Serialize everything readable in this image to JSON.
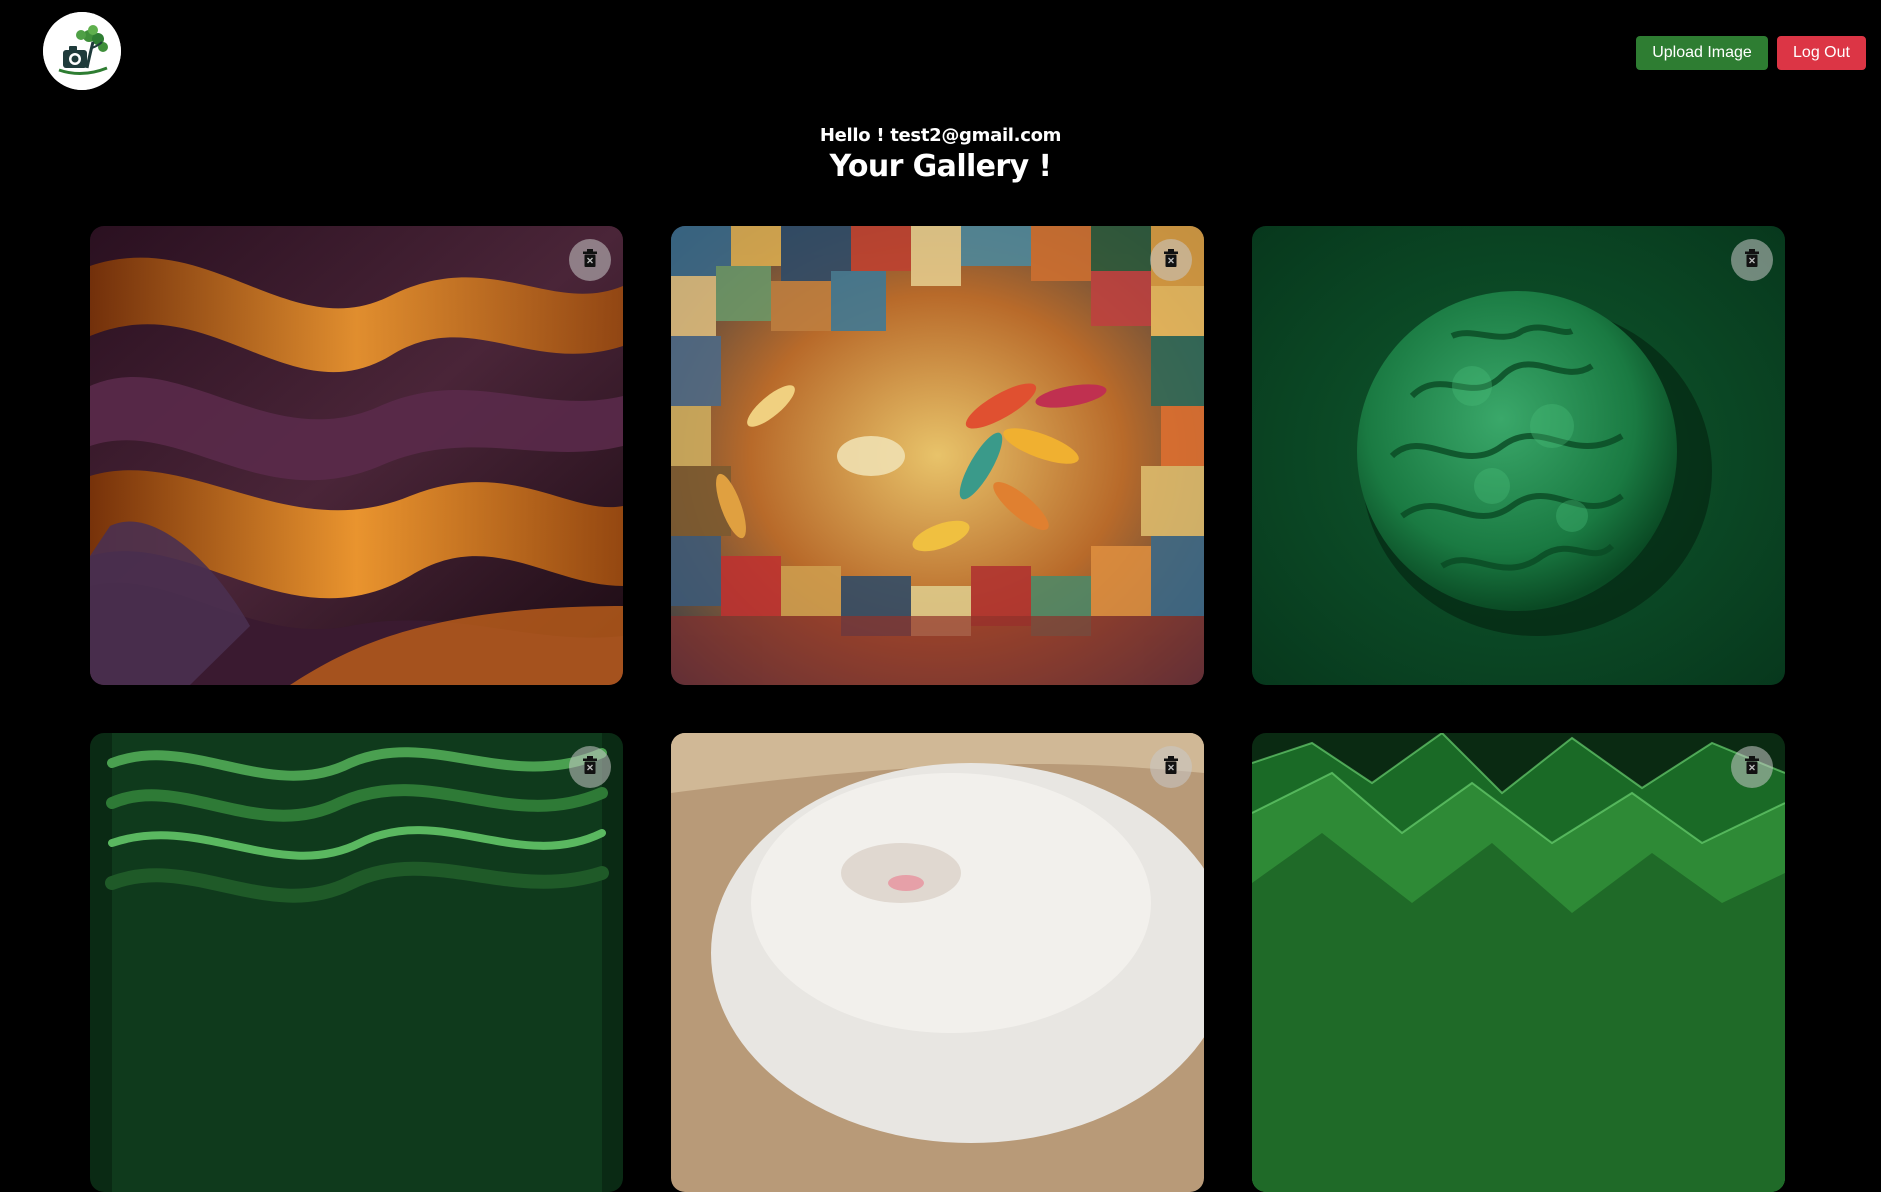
{
  "header": {
    "logo_icon": "camera-tree-logo-icon",
    "upload_label": "Upload Image",
    "logout_label": "Log Out",
    "colors": {
      "upload": "#2e7d32",
      "logout": "#dc3545"
    }
  },
  "greeting": {
    "hello": "Hello ! test2@gmail.com",
    "title": "Your Gallery !"
  },
  "gallery": {
    "delete_icon": "trash-icon",
    "items": [
      {
        "subject": "orange and purple flowing silk waves"
      },
      {
        "subject": "colorful mosaic with autumn leaves"
      },
      {
        "subject": "green sculpted brain-like form"
      },
      {
        "subject": "green flowing silk waves"
      },
      {
        "subject": "white fluffy animal"
      },
      {
        "subject": "green mountain-like fabric ridges"
      }
    ]
  }
}
